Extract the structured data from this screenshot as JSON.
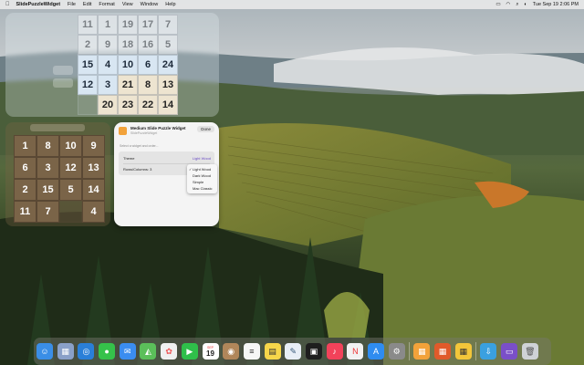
{
  "menubar": {
    "app_name": "SlidePuzzleWidget",
    "items": [
      "File",
      "Edit",
      "Format",
      "View",
      "Window",
      "Help"
    ],
    "datetime": "Tue Sep 19  2:06 PM"
  },
  "widget_large": {
    "tiles": [
      "11",
      "1",
      "19",
      "17",
      "7",
      "2",
      "9",
      "18",
      "16",
      "5",
      "15",
      "4",
      "10",
      "6",
      "24",
      "12",
      "3",
      "21",
      "8",
      "13",
      "",
      "20",
      "23",
      "22",
      "14"
    ]
  },
  "widget_small": {
    "tiles": [
      "1",
      "8",
      "10",
      "9",
      "6",
      "3",
      "12",
      "13",
      "2",
      "15",
      "5",
      "14",
      "11",
      "7",
      "",
      "4"
    ]
  },
  "settings_panel": {
    "title": "Medium Slide Puzzle Widget",
    "subtitle": "SlidePuzzleWidget",
    "done_label": "Done",
    "hint": "Select a widget and order...",
    "theme_label": "Theme",
    "theme_value": "Light Wood",
    "rows_label": "Rows/Columns: 3"
  },
  "theme_menu": {
    "options": [
      "Light Wood",
      "Dark Wood",
      "Simple",
      "Mac Classic"
    ],
    "selected": "Light Wood"
  },
  "dock": {
    "calendar_month": "SEP",
    "calendar_day": "19",
    "apps": [
      {
        "name": "finder-icon",
        "color": "#3a8ee6"
      },
      {
        "name": "launchpad-icon",
        "color": "#8aa0c8"
      },
      {
        "name": "safari-icon",
        "color": "#2a7fd8"
      },
      {
        "name": "messages-icon",
        "color": "#35c24a"
      },
      {
        "name": "mail-icon",
        "color": "#3b8df0"
      },
      {
        "name": "maps-icon",
        "color": "#5bbf5a"
      },
      {
        "name": "photos-icon",
        "color": "#f0f0f0"
      },
      {
        "name": "facetime-icon",
        "color": "#2fbf4a"
      },
      {
        "name": "calendar-icon",
        "color": "#ffffff"
      },
      {
        "name": "contacts-icon",
        "color": "#b0865a"
      },
      {
        "name": "reminders-icon",
        "color": "#f6f6f6"
      },
      {
        "name": "notes-icon",
        "color": "#f7d64a"
      },
      {
        "name": "freeform-icon",
        "color": "#e8eef6"
      },
      {
        "name": "tv-icon",
        "color": "#1e1e1e"
      },
      {
        "name": "music-icon",
        "color": "#f2425a"
      },
      {
        "name": "news-icon",
        "color": "#f2f2f2"
      },
      {
        "name": "app-store-icon",
        "color": "#2f8cf0"
      },
      {
        "name": "system-settings-icon",
        "color": "#8a8a8a"
      },
      {
        "name": "puzzle-app-icon",
        "color": "#f2a23a"
      },
      {
        "name": "puzzle-app-2-icon",
        "color": "#e05a2a"
      },
      {
        "name": "puzzle-app-3-icon",
        "color": "#f3c63a"
      },
      {
        "name": "downloads-icon",
        "color": "#3aa0e0"
      },
      {
        "name": "screenshots-icon",
        "color": "#7a4fc8"
      },
      {
        "name": "trash-icon",
        "color": "#cfd2d6"
      }
    ]
  }
}
